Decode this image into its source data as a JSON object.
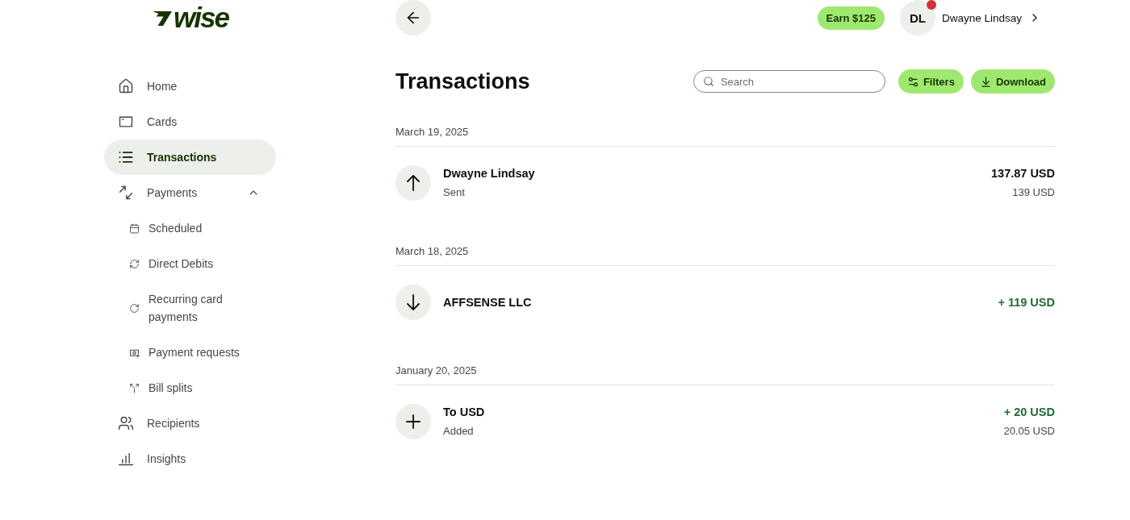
{
  "logo": {
    "text": "wise"
  },
  "sidebar": {
    "items": [
      {
        "label": "Home",
        "kind": "home",
        "selected": false
      },
      {
        "label": "Cards",
        "kind": "card",
        "selected": false
      },
      {
        "label": "Transactions",
        "kind": "list",
        "selected": true
      },
      {
        "label": "Payments",
        "kind": "payments",
        "selected": false,
        "expanded": true,
        "children": [
          {
            "label": "Scheduled",
            "kind": "calendar",
            "selected": false
          },
          {
            "label": "Direct Debits",
            "kind": "refresh",
            "selected": false
          },
          {
            "label": "Recurring card payments",
            "kind": "repeat",
            "selected": false
          },
          {
            "label": "Payment requests",
            "kind": "request",
            "selected": false
          },
          {
            "label": "Bill splits",
            "kind": "split",
            "selected": false
          }
        ]
      },
      {
        "label": "Recipients",
        "kind": "people",
        "selected": false
      },
      {
        "label": "Insights",
        "kind": "chart",
        "selected": false
      }
    ]
  },
  "header": {
    "earn_button": "Earn $125",
    "profile": {
      "initials": "DL",
      "name": "Dwayne Lindsay",
      "notification": true
    }
  },
  "page": {
    "title": "Transactions",
    "search": {
      "placeholder": "Search"
    },
    "buttons": [
      {
        "label": "Filters",
        "kind": "filters"
      },
      {
        "label": "Download",
        "kind": "download"
      }
    ]
  },
  "transactions": [
    {
      "date": "March 19, 2025",
      "items": [
        {
          "kind": "sent",
          "name": "Dwayne Lindsay",
          "status": "Sent",
          "amount": "137.87 USD",
          "original_amount": "139 USD",
          "incoming": false
        }
      ]
    },
    {
      "date": "March 18, 2025",
      "items": [
        {
          "kind": "received",
          "name": "AFFSENSE LLC",
          "amount": "+ 119 USD",
          "incoming": true
        }
      ]
    },
    {
      "date": "January 20, 2025",
      "items": [
        {
          "kind": "added",
          "name": "To USD",
          "status": "Added",
          "amount": "+ 20 USD",
          "original_amount": "20.05 USD",
          "incoming": true
        }
      ]
    }
  ]
}
